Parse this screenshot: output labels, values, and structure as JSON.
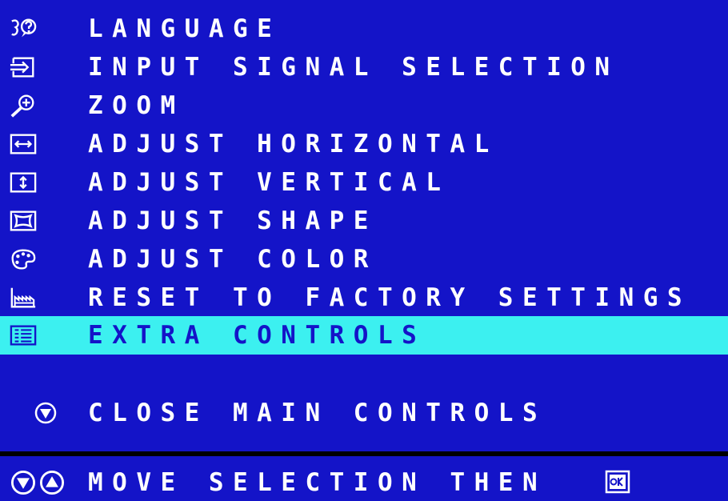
{
  "menu": {
    "items": [
      {
        "label": "LANGUAGE",
        "icon": "language-icon"
      },
      {
        "label": "INPUT SIGNAL SELECTION",
        "icon": "input-signal-icon"
      },
      {
        "label": "ZOOM",
        "icon": "zoom-icon"
      },
      {
        "label": "ADJUST HORIZONTAL",
        "icon": "horizontal-arrows-icon"
      },
      {
        "label": "ADJUST VERTICAL",
        "icon": "vertical-arrows-icon"
      },
      {
        "label": "ADJUST SHAPE",
        "icon": "shape-icon"
      },
      {
        "label": "ADJUST COLOR",
        "icon": "palette-icon"
      },
      {
        "label": "RESET TO FACTORY SETTINGS",
        "icon": "factory-icon"
      },
      {
        "label": "EXTRA CONTROLS",
        "icon": "extra-controls-icon",
        "selected": true
      }
    ],
    "close": {
      "label": "CLOSE MAIN CONTROLS",
      "icon": "down-arrow-circle-icon"
    }
  },
  "footer": {
    "label": "MOVE SELECTION THEN",
    "icons": [
      "down-arrow-circle-icon",
      "up-arrow-circle-icon",
      "ok-icon"
    ]
  },
  "colors": {
    "background": "#1414c8",
    "text": "#ffffff",
    "highlight": "#3cf0f0",
    "divider": "#000000"
  }
}
